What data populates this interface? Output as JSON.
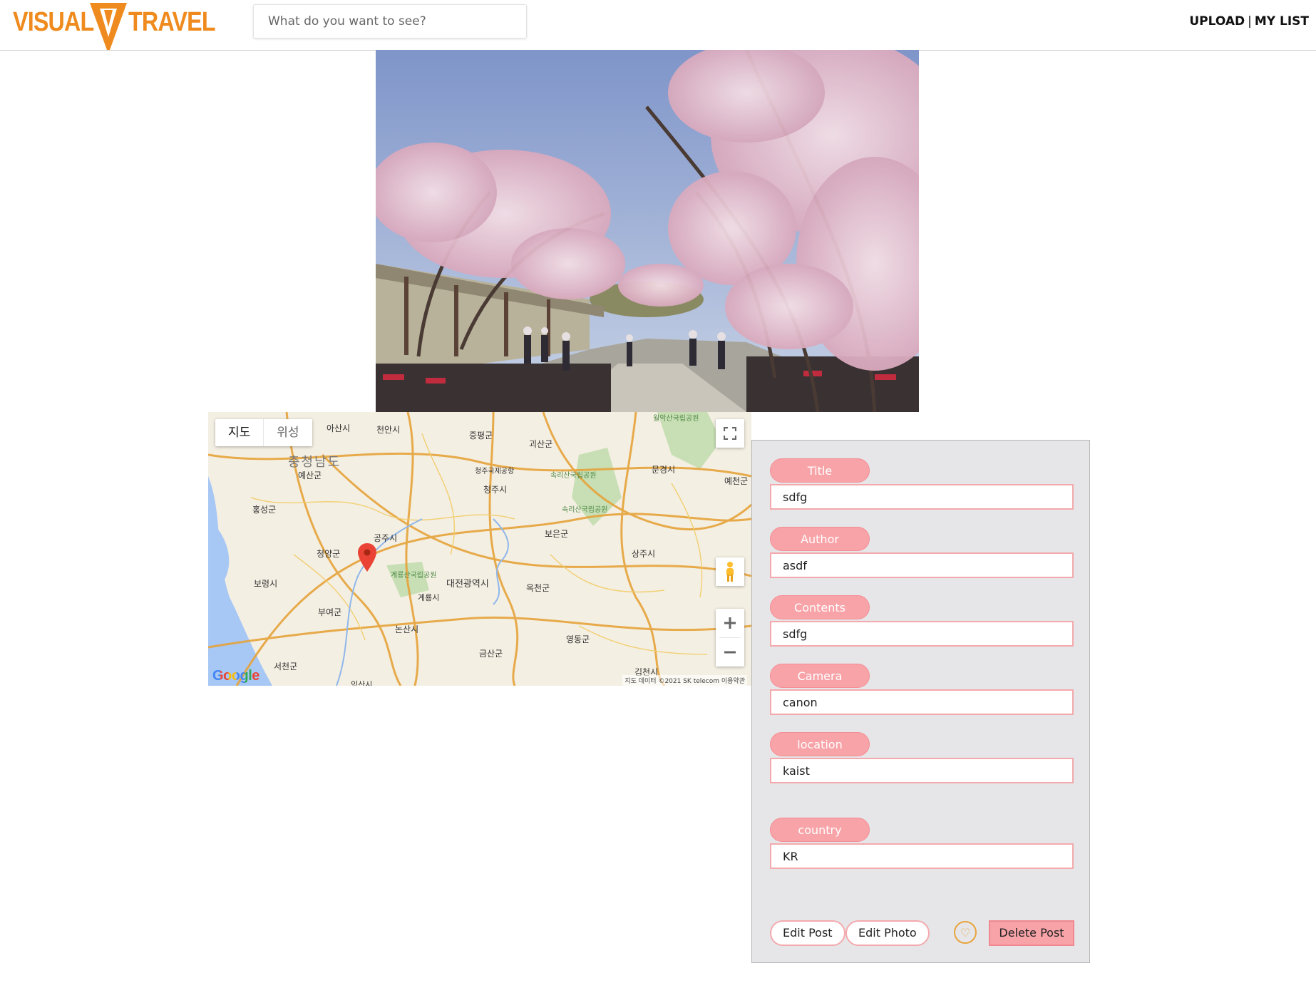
{
  "header": {
    "logo_left": "VISUAL",
    "logo_right": "TRAVEL",
    "search_placeholder": "What do you want to see?",
    "nav_upload": "UPLOAD",
    "nav_separator": "|",
    "nav_mylist": "MY LIST"
  },
  "map": {
    "type_map": "지도",
    "type_satellite": "위성",
    "google": "Google",
    "attribution": "지도 데이터 ©2021 SK telecom   이용약관",
    "labels": {
      "asan": "아산시",
      "cheonan": "천안시",
      "jeungpyeong": "증평군",
      "goesan": "괴산군",
      "woraksan": "월악산국립공원",
      "chungnam": "충청남도",
      "yesan": "예산군",
      "cheongju_airport": "청주국제공항",
      "songnisan1": "속리산국립공원",
      "mungyeong": "문경시",
      "yecheon": "예천군",
      "cheongju": "청주시",
      "hongseong": "홍성군",
      "songnisan2": "속리산국립공원",
      "gongju": "공주시",
      "boeun": "보은군",
      "cheongyang": "청양군",
      "sangju": "상주시",
      "gyeryongsan": "계룡산국립공원",
      "daejeon": "대전광역시",
      "boryeong": "보령시",
      "okcheon": "옥천군",
      "gyeryong": "계룡시",
      "buyeo": "부여군",
      "nonsan": "논산시",
      "yeongdong": "영동군",
      "geumsan": "금산군",
      "seocheon": "서천군",
      "gimcheon": "김천시",
      "iksan": "익산시"
    }
  },
  "panel": {
    "title_label": "Title",
    "title_value": "sdfg",
    "author_label": "Author",
    "author_value": "asdf",
    "contents_label": "Contents",
    "contents_value": "sdfg",
    "camera_label": "Camera",
    "camera_value": "canon",
    "location_label": "location",
    "location_value": "kaist",
    "country_label": "country",
    "country_value": "KR",
    "edit_post": "Edit Post",
    "edit_photo": "Edit Photo",
    "like_icon": "♡",
    "delete_post": "Delete Post"
  }
}
